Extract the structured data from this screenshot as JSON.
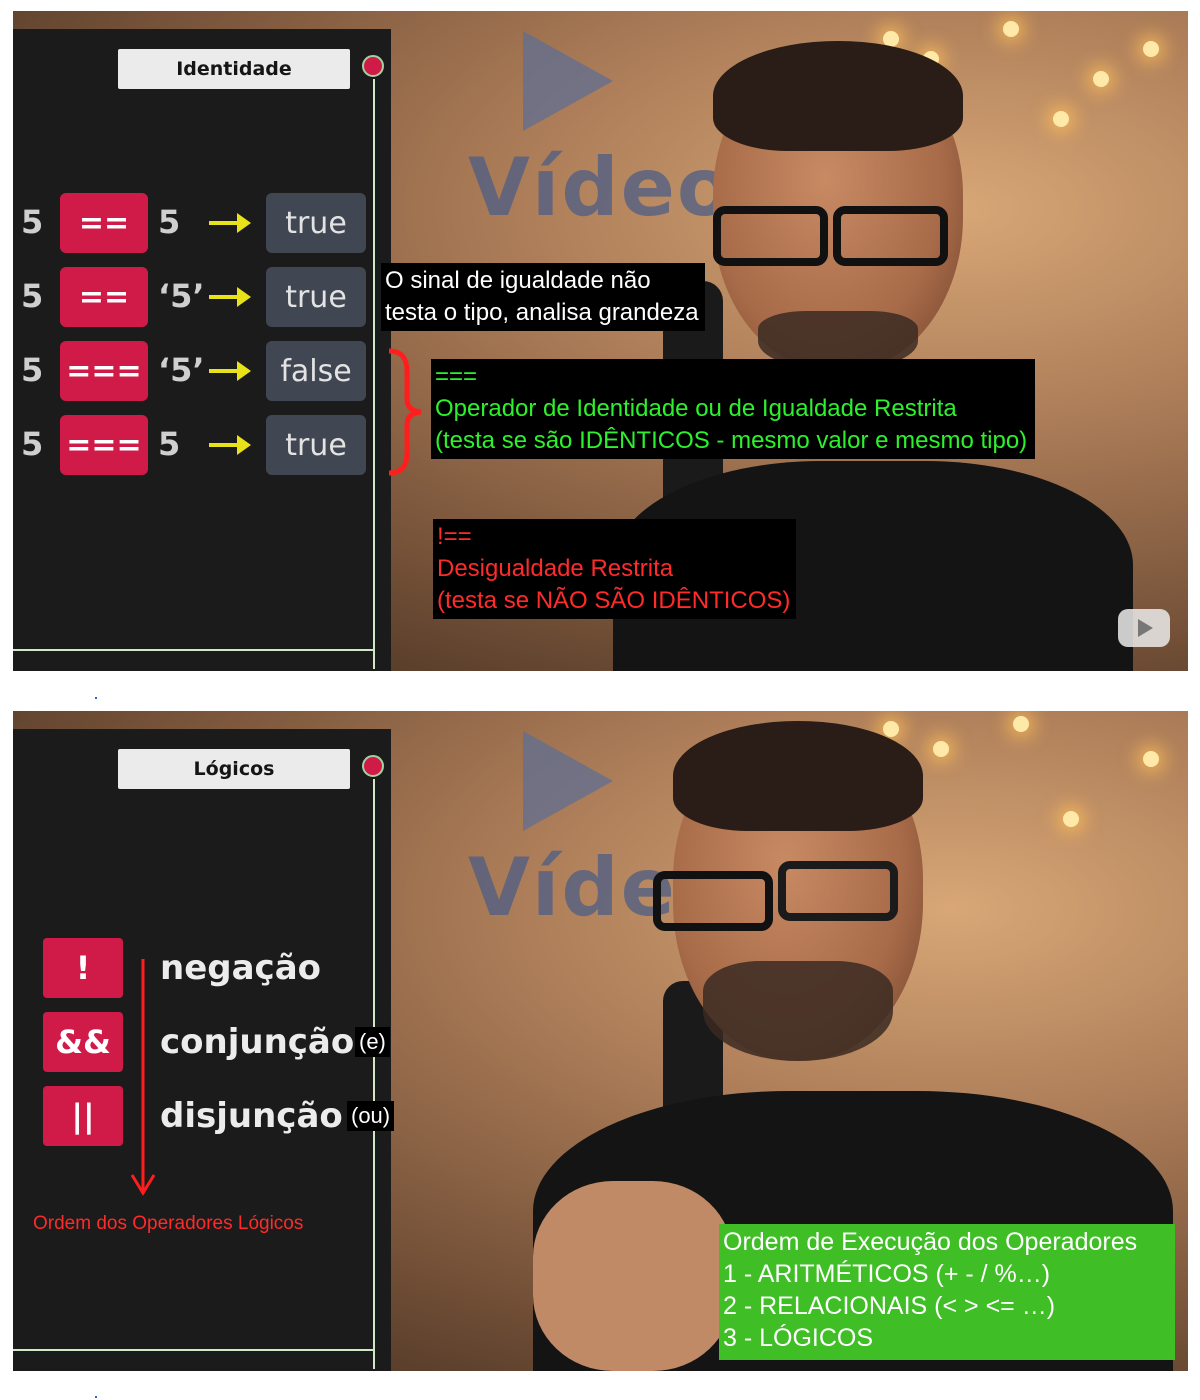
{
  "frame1": {
    "panel_title": "Identidade",
    "rows": [
      {
        "lhs": "5",
        "op": "==",
        "rhs": "5",
        "result": "true"
      },
      {
        "lhs": "5",
        "op": "==",
        "rhs": "‘5’",
        "result": "true"
      },
      {
        "lhs": "5",
        "op": "===",
        "rhs": "‘5’",
        "result": "false"
      },
      {
        "lhs": "5",
        "op": "===",
        "rhs": "5",
        "result": "true"
      }
    ],
    "caption_white": [
      "O sinal de igualdade não",
      "testa o tipo, analisa grandeza"
    ],
    "caption_green": [
      "===",
      "Operador de Identidade ou de Igualdade Restrita",
      "(testa se são IDÊNTICOS - mesmo valor e mesmo tipo)"
    ],
    "caption_red": [
      "!==",
      "Desigualdade Restrita",
      "(testa se NÃO SÃO IDÊNTICOS)"
    ],
    "background_logo_text": "Vídeo"
  },
  "frame2": {
    "panel_title": "Lógicos",
    "operators": [
      {
        "symbol": "!",
        "word": "negação",
        "note": ""
      },
      {
        "symbol": "&&",
        "word": "conjunção",
        "note": "(e)"
      },
      {
        "symbol": "||",
        "word": "disjunção",
        "note": "(ou)"
      }
    ],
    "order_label": "Ordem dos Operadores Lógicos",
    "execution_order": [
      "Ordem de Execução dos Operadores",
      "1 - ARITMÉTICOS (+ - / %…)",
      "2 - RELACIONAIS (< > <= …)",
      "3 - LÓGICOS"
    ],
    "background_logo_text": "Vídeo"
  },
  "colors": {
    "accent_red": "#d01b48",
    "panel_bg": "#1b1b1b",
    "result_bg": "#414653",
    "arrow_yellow": "#e8e21a",
    "caption_green": "#2df12d",
    "caption_red": "#ff2a2a",
    "order_box_green": "#3fbe26"
  }
}
